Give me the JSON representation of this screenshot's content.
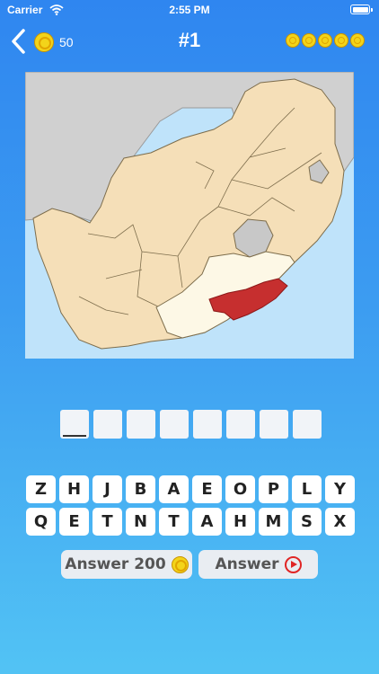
{
  "status_bar": {
    "carrier": "Carrier",
    "time": "2:55 PM"
  },
  "nav": {
    "back_icon": "chevron-left-icon",
    "coins": "50",
    "level": "#1",
    "progress_coins": 5
  },
  "map": {
    "highlight_color": "#c62f2f",
    "province_color": "#fdf8e6",
    "country_color": "#f5dfb8",
    "neighbor_color": "#d0d0d0",
    "sea_color": "#bfe3fa"
  },
  "answer": {
    "slot_count": 8,
    "filled": [
      "",
      "",
      "",
      "",
      "",
      "",
      "",
      ""
    ]
  },
  "keyboard": {
    "row1": [
      "Z",
      "H",
      "J",
      "B",
      "A",
      "E",
      "O",
      "P",
      "L",
      "Y"
    ],
    "row2": [
      "Q",
      "E",
      "T",
      "N",
      "T",
      "A",
      "H",
      "M",
      "S",
      "X"
    ]
  },
  "hints": {
    "answer_coins_label": "Answer 200",
    "answer_video_label": "Answer"
  }
}
